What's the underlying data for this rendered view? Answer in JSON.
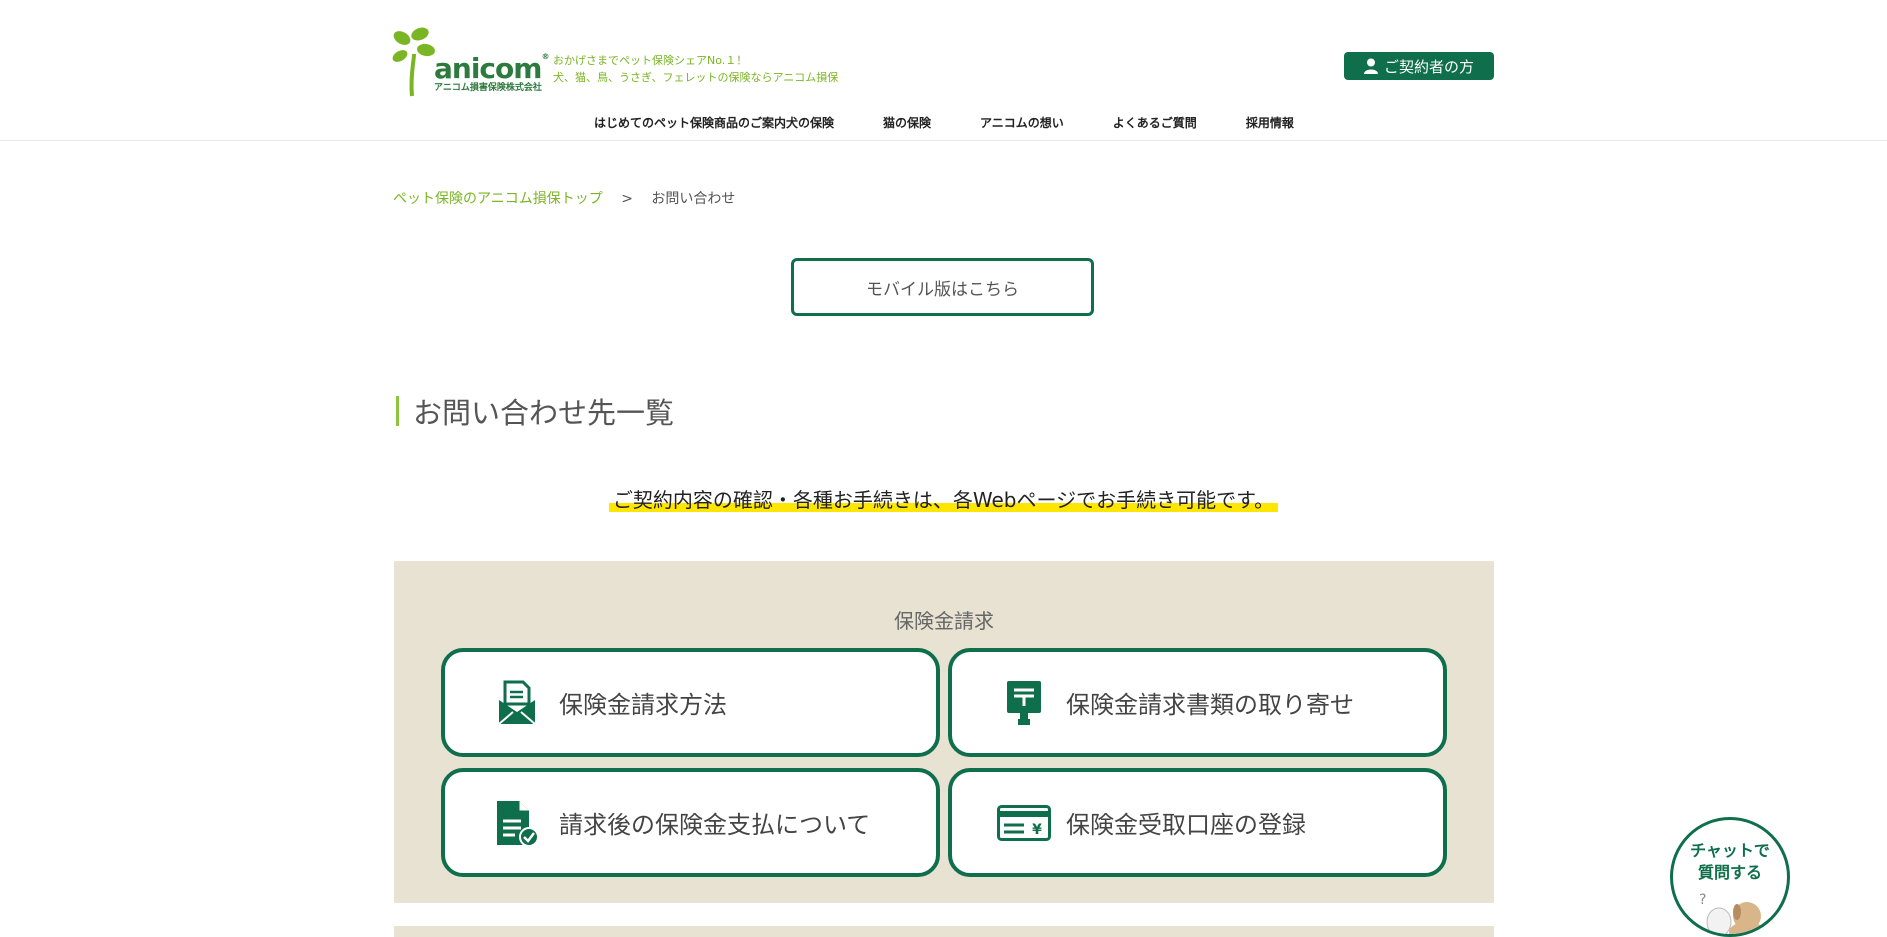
{
  "header": {
    "logo_text": "anicom",
    "logo_subtext": "アニコム損害保険株式会社",
    "tagline_line1": "おかげさまでペット保険シェアNo.１！",
    "tagline_line2": "犬、猫、鳥、うさぎ、フェレットの保険ならアニコム損保",
    "contractor_button": "ご契約者の方",
    "nav": [
      {
        "label": "はじめてのペット保険商品のご案内犬の保険"
      },
      {
        "label": "猫の保険"
      },
      {
        "label": "アニコムの想い"
      },
      {
        "label": "よくあるご質問"
      },
      {
        "label": "採用情報"
      }
    ]
  },
  "breadcrumb": {
    "home": "ペット保険のアニコム損保トップ",
    "separator": ">",
    "current": "お問い合わせ"
  },
  "mobile_button": "モバイル版はこちら",
  "page_title": "お問い合わせ先一覧",
  "notice": "ご契約内容の確認・各種お手続きは、各Webページでお手続き可能です。",
  "claims_section": {
    "title": "保険金請求",
    "cards": [
      {
        "label": "保険金請求方法",
        "icon": "envelope-document-icon"
      },
      {
        "label": "保険金請求書類の取り寄せ",
        "icon": "mailbox-icon"
      },
      {
        "label": "請求後の保険金支払について",
        "icon": "document-check-icon"
      },
      {
        "label": "保険金受取口座の登録",
        "icon": "bank-card-icon"
      }
    ]
  },
  "chat_button": {
    "line1": "チャットで",
    "line2": "質問する"
  },
  "colors": {
    "primary_green": "#0f6e4c",
    "accent_lime": "#7ab524",
    "panel_beige": "#e8e2d3",
    "highlight_yellow": "#ffe600"
  }
}
